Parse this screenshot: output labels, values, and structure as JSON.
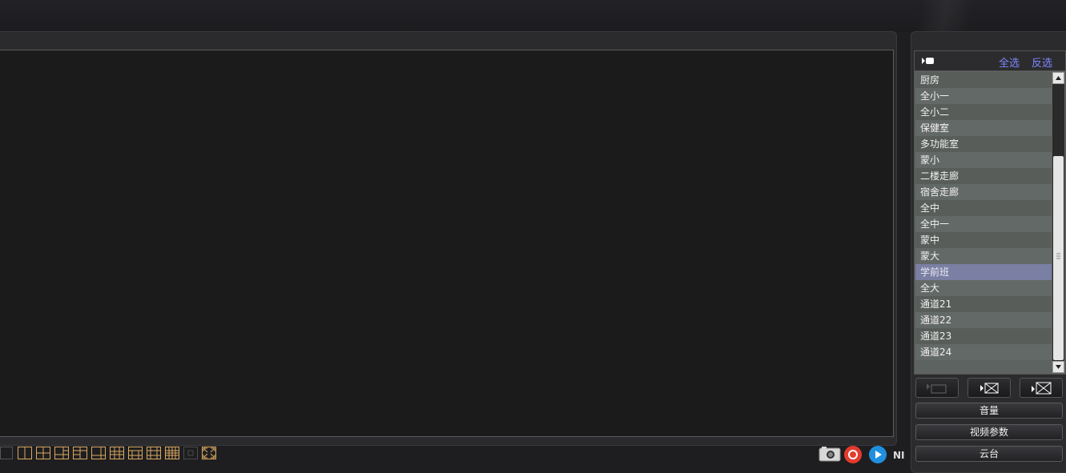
{
  "channel_panel": {
    "select_all": "全选",
    "invert_select": "反选",
    "channels": [
      "厨房",
      "全小一",
      "全小二",
      "保健室",
      "多功能室",
      "蒙小",
      "二楼走廊",
      "宿舍走廊",
      "全中",
      "全中一",
      "蒙中",
      "蒙大",
      "学前班",
      "全大",
      "通道21",
      "通道22",
      "通道23",
      "通道24"
    ],
    "selected_channel": "学前班"
  },
  "buttons": {
    "volume": "音量",
    "video_params": "视频参数",
    "ptz": "云台"
  },
  "logo_fragment": "NI",
  "colors": {
    "accent_link": "#7e86ff",
    "layout_icon": "#d9a860",
    "selected_row": "#7a7fa3",
    "record": "#e53b2c",
    "play": "#1f8fe0"
  },
  "icons": {
    "layouts": [
      "layout-1-icon",
      "layout-2-icon",
      "layout-4-icon",
      "layout-6-icon",
      "layout-8-icon",
      "layout-9-icon",
      "layout-13-icon",
      "layout-16-icon",
      "layout-25-icon",
      "layout-36-icon",
      "fullscreen-icon"
    ],
    "controls": [
      "snapshot-icon",
      "record-icon",
      "play-icon"
    ]
  }
}
